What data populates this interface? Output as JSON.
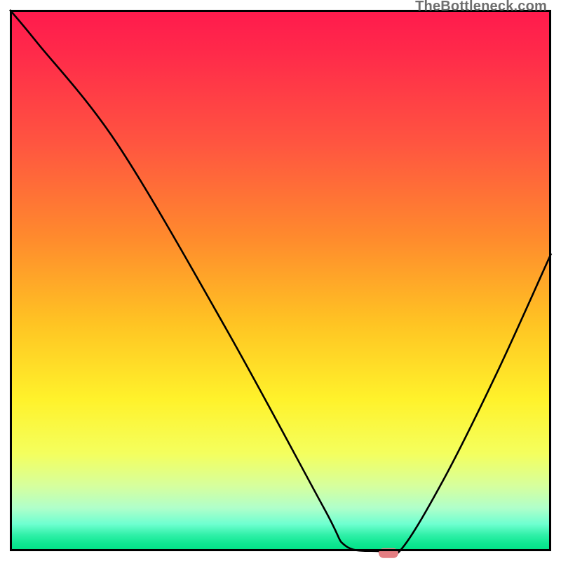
{
  "watermark": "TheBottleneck.com",
  "chart_data": {
    "type": "line",
    "title": "",
    "xlabel": "",
    "ylabel": "",
    "xlim": [
      0,
      100
    ],
    "ylim": [
      0,
      100
    ],
    "grid": false,
    "series": [
      {
        "name": "curve",
        "x": [
          0,
          5,
          20,
          40,
          58,
          62,
          68,
          72,
          80,
          90,
          100
        ],
        "values": [
          100,
          94,
          75,
          41,
          8,
          1,
          0,
          0,
          13,
          33,
          55
        ]
      }
    ],
    "marker": {
      "x": 70,
      "y": 0
    },
    "colors": {
      "gradient_top": "#ff1a4d",
      "gradient_mid": "#ffd22b",
      "gradient_bot": "#00e085",
      "line": "#000000",
      "marker": "#e47e82",
      "frame": "#000000"
    }
  }
}
